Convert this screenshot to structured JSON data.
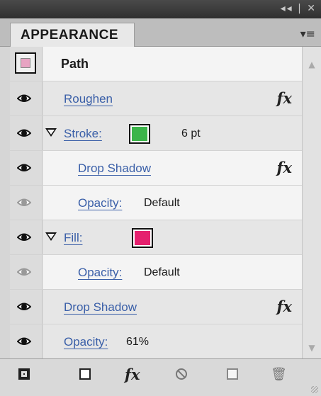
{
  "window": {
    "controls": "◂◂ | ✕"
  },
  "panel": {
    "title": "APPEARANCE",
    "menu_icon": "panel-menu-icon"
  },
  "rows": [
    {
      "kind": "header",
      "label": "Path"
    },
    {
      "kind": "effect",
      "label": "Roughen",
      "fx": "fx",
      "eye": true
    },
    {
      "kind": "stroke",
      "label": "Stroke:",
      "value": "6 pt",
      "color": "#3bb54a",
      "eye": true
    },
    {
      "kind": "effect",
      "label": "Drop Shadow",
      "fx": "fx",
      "eye": true
    },
    {
      "kind": "opacity",
      "label": "Opacity:",
      "value": "Default",
      "eye": true
    },
    {
      "kind": "fill",
      "label": "Fill:",
      "color": "#e5206e",
      "eye": true
    },
    {
      "kind": "opacity",
      "label": "Opacity:",
      "value": "Default",
      "eye": true
    },
    {
      "kind": "effect",
      "label": "Drop Shadow",
      "fx": "fx",
      "eye": true
    },
    {
      "kind": "opacity",
      "label": "Opacity:",
      "value": "61%",
      "eye": true
    }
  ],
  "toolbar": {
    "add_stroke_icon": "add-new-stroke-icon",
    "add_fill_icon": "add-new-fill-icon",
    "fx_label": "fx",
    "clear_icon": "clear-appearance-icon",
    "duplicate_icon": "duplicate-item-icon",
    "delete_icon": "delete-item-icon"
  }
}
